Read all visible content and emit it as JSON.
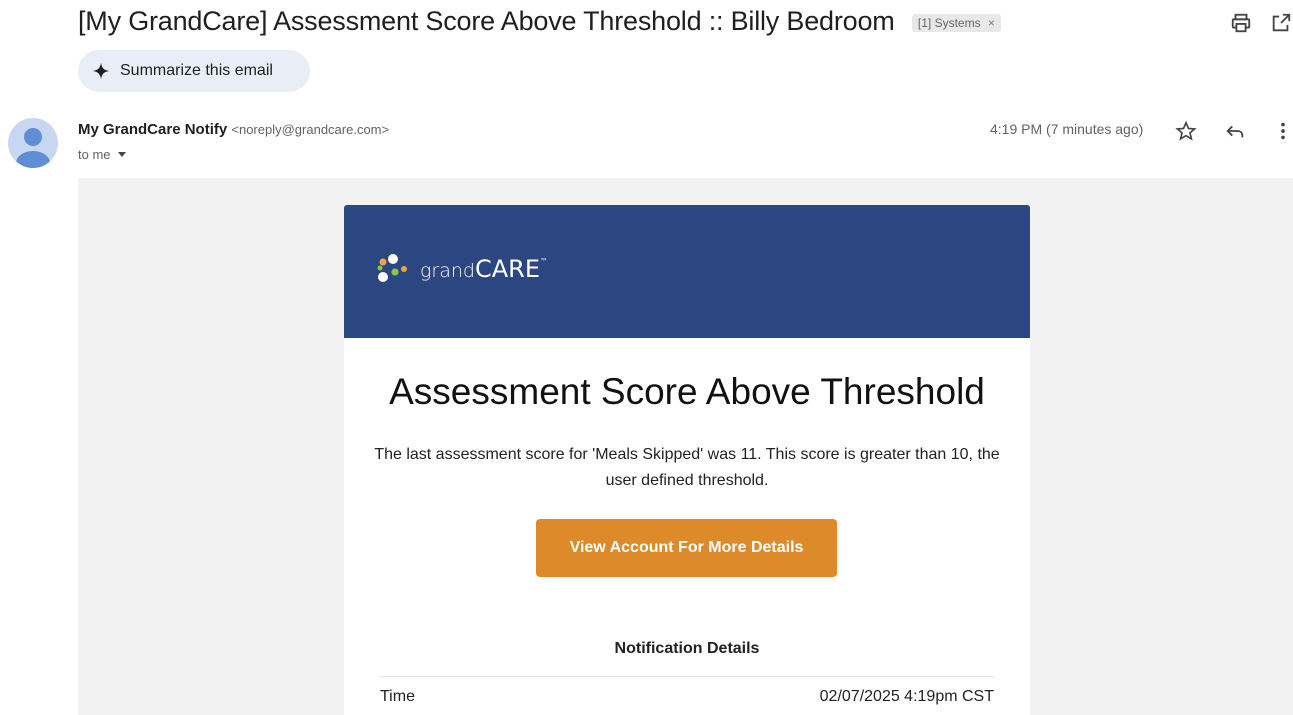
{
  "header": {
    "subject": "[My GrandCare] Assessment Score Above Threshold :: Billy Bedroom",
    "label_chip": "[1] Systems",
    "label_close": "×",
    "summarize_label": "Summarize this email"
  },
  "message": {
    "sender_name": "My GrandCare Notify",
    "sender_email": "<noreply@grandcare.com>",
    "recipient": "to me",
    "timestamp": "4:19 PM (7 minutes ago)"
  },
  "icons": {
    "print": "print-icon",
    "popout": "open-in-new-window-icon",
    "star": "star-icon",
    "reply": "reply-icon",
    "more": "more-vert-icon",
    "summarize": "sparkle-icon"
  },
  "email": {
    "logo_text_grand": "grand",
    "logo_text_care": "CARE",
    "logo_tm": "™",
    "headline": "Assessment Score Above Threshold",
    "body": "The last assessment score for 'Meals Skipped' was 11. This score is greater than 10, the user defined threshold.",
    "cta_label": "View Account For More Details",
    "details_title": "Notification Details",
    "details": [
      {
        "label": "Time",
        "value": "02/07/2025 4:19pm CST"
      }
    ]
  },
  "colors": {
    "banner": "#2b4681",
    "cta": "#dd8a2b",
    "email_background": "#f2f2f2"
  }
}
